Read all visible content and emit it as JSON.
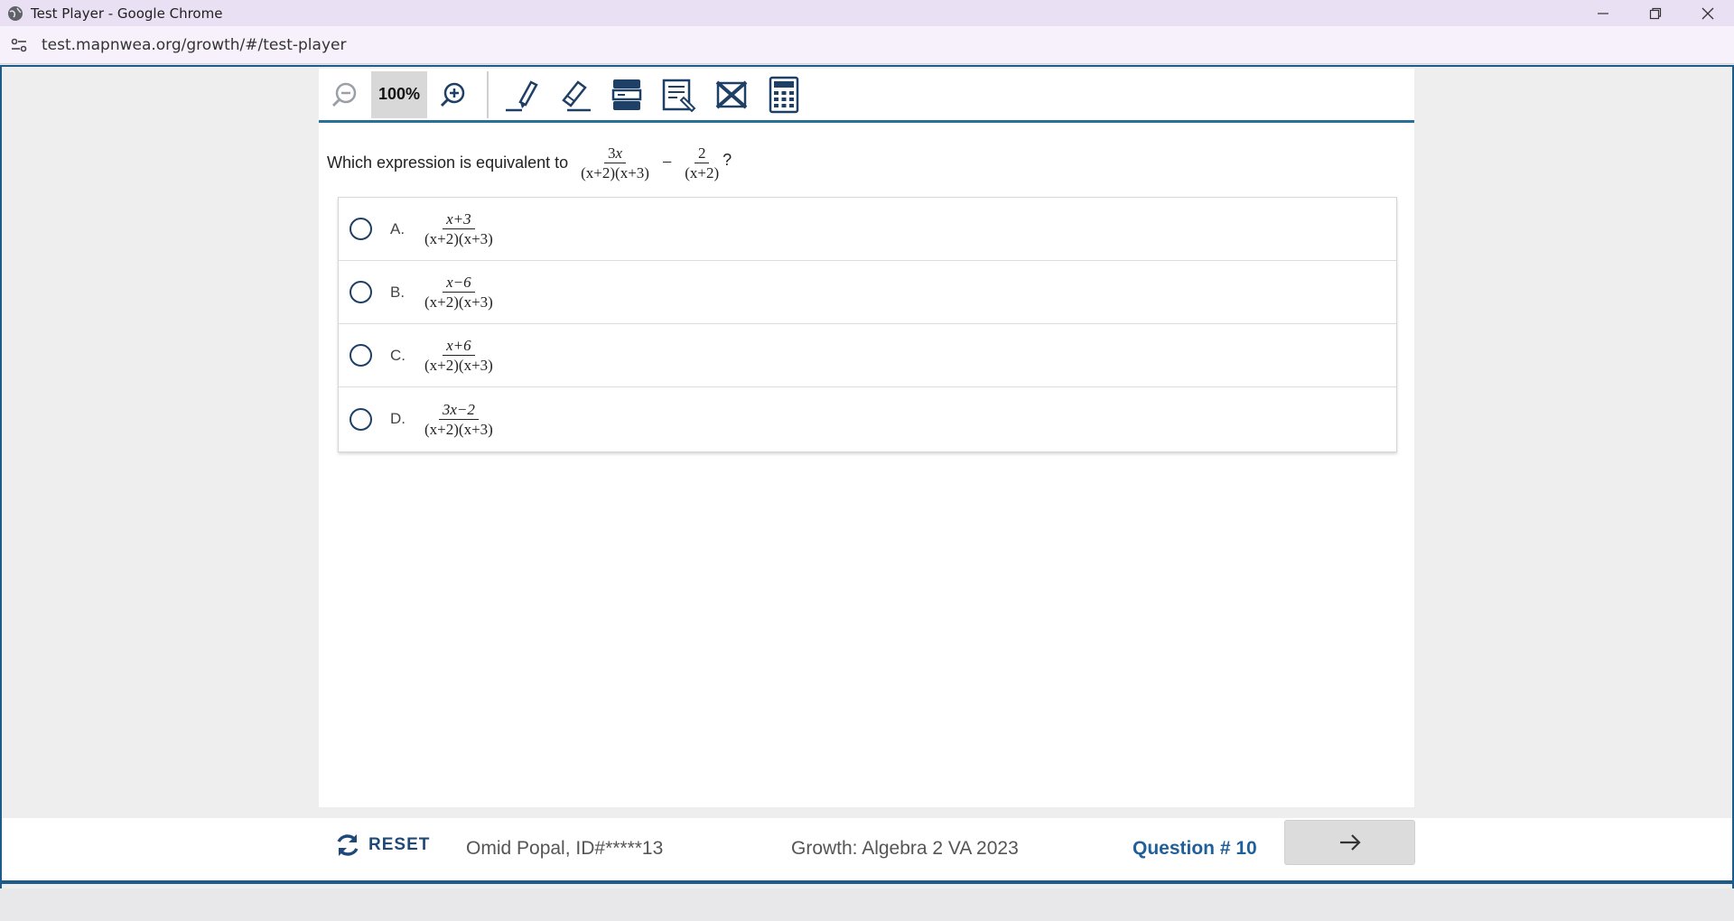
{
  "window": {
    "title": "Test Player - Google Chrome",
    "url": "test.mapnwea.org/growth/#/test-player"
  },
  "toolbar": {
    "zoom_level": "100%",
    "tools": [
      "zoom-out-icon",
      "zoom-in-icon",
      "highlighter-icon",
      "eraser-icon",
      "line-reader-icon",
      "notepad-icon",
      "answer-eliminator-icon",
      "calculator-icon"
    ]
  },
  "question": {
    "prompt": "Which expression is equivalent to",
    "term1_num_coef": "3",
    "term1_num_var": "x",
    "term1_den": "(x+2)(x+3)",
    "operator": "−",
    "term2_num": "2",
    "term2_den": "(x+2)",
    "end": "?"
  },
  "choices": [
    {
      "letter": "A.",
      "num": "x+3",
      "den": "(x+2)(x+3)"
    },
    {
      "letter": "B.",
      "num": "x−6",
      "den": "(x+2)(x+3)"
    },
    {
      "letter": "C.",
      "num": "x+6",
      "den": "(x+2)(x+3)"
    },
    {
      "letter": "D.",
      "num": "3x−2",
      "den": "(x+2)(x+3)"
    }
  ],
  "footer": {
    "reset_label": "RESET",
    "student": "Omid Popal, ID#*****13",
    "test_name": "Growth: Algebra 2 VA 2023",
    "question_number": "Question # 10"
  },
  "colors": {
    "accent": "#1d5c8a",
    "link_blue": "#1f5f9a",
    "titlebar": "#e9e0f3"
  }
}
